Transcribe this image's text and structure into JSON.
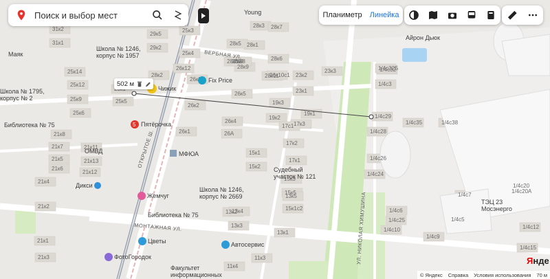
{
  "search": {
    "placeholder": "Поиск и выбор мест"
  },
  "top_buttons": {
    "planimeter": "Планиметр",
    "ruler": "Линейка"
  },
  "measure": {
    "distance": "502 м"
  },
  "pois": {
    "fixprice": "Fix Price",
    "chizhik": "Чижик",
    "pyaterochka": "Пятёрочка",
    "dixy": "Дикси",
    "zhemchug": "Жемчуг",
    "tsvety": "Цветы",
    "fotogorodok": "ФотоГородок",
    "avtoservis": "Автосервис",
    "young": "Young",
    "airon": "Айрон Дьюк",
    "school1": "Школа № 1246,\nкорпус № 1957",
    "school2": "Школа № 1246,\nкорпус № 2669",
    "school3": "Школа № 1795,\nкорпус № 2",
    "library1": "Библиотека № 75",
    "library2": "Библиотека № 75",
    "mfyua": "МФЮА",
    "court": "Судебный\nучасток № 121",
    "omvd": "ОМВД",
    "mayak": "Маяк",
    "tec": "ТЭЦ 23\nМосэнерго",
    "faculty": "Факультет\nинформационных"
  },
  "streets": {
    "montazhnaya": "МОНТАЖНАЯ УЛ.",
    "verbnaya": "ВЕРБНАЯ УЛ.",
    "otkrytoe": "ОТКРЫТОЕ Ш.",
    "khimushina": "УЛ. НИКОЛАЯ ХИМУШИНА"
  },
  "buildings": [
    "29к5",
    "29к2",
    "28к3",
    "28к1",
    "28к7",
    "28к5",
    "28к6",
    "28к9",
    "28к11",
    "28к12",
    "26к9",
    "26к8",
    "26к10с1",
    "25к14",
    "25к12",
    "25к9",
    "25к6",
    "25к5",
    "25к1",
    "26к1",
    "26к2",
    "26к4",
    "26к5",
    "26А",
    "23к3",
    "23к2",
    "23к1",
    "19к1",
    "19к2",
    "19к3",
    "17к3",
    "17к2",
    "17к1",
    "15к1",
    "15к2",
    "15к3",
    "15к5",
    "15к1с2",
    "13к5",
    "13к2",
    "13к3",
    "13к1",
    "13к4",
    "11к4",
    "11к3",
    "21к3",
    "21к1",
    "21к2",
    "21к4",
    "21к11",
    "21к13",
    "21к12",
    "21к5",
    "21к6",
    "21к7",
    "21к8",
    "1/4с3",
    "1/4с29",
    "1/4с35",
    "1/4с38",
    "1/4с32",
    "1/4с28",
    "1/4с26",
    "1/4с24",
    "1/4с20",
    "1/4с20А",
    "1/4с7",
    "1/4с5",
    "1/4с6",
    "1/4с9",
    "1/4с10",
    "1/4с12",
    "1/4с15",
    "1/4с25",
    "1/4с32Б",
    "31к2",
    "31к1",
    "25к3",
    "25к4",
    "28к2",
    "26к12",
    "26к3",
    "17с1"
  ],
  "footer": {
    "copyright": "© Яндекс",
    "help": "Справка",
    "terms": "Условия использования",
    "scale": "70 м"
  },
  "logo": {
    "text": "Янде"
  }
}
